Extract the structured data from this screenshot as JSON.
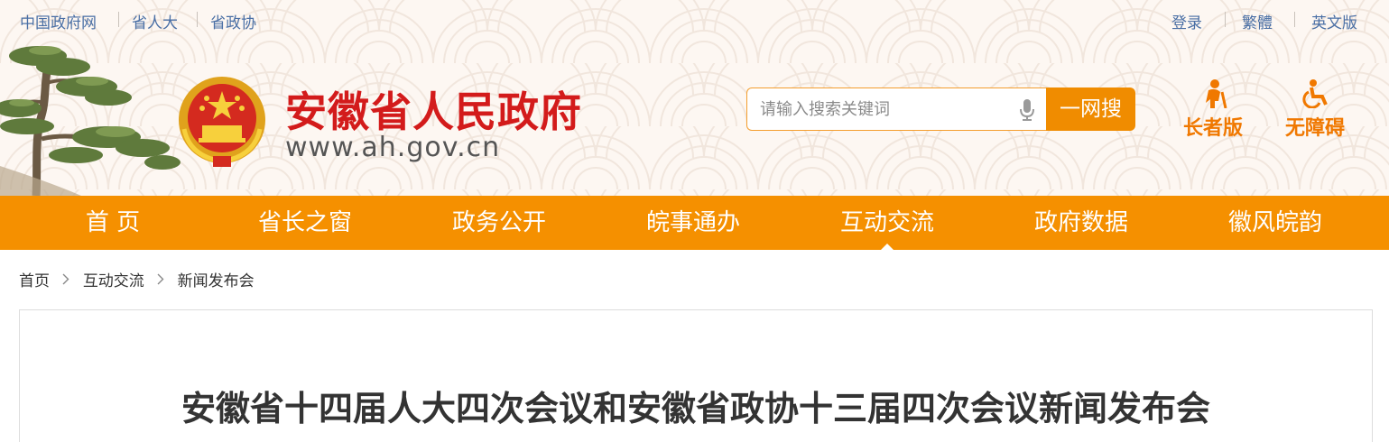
{
  "colors": {
    "accent_orange": "#f59000",
    "title_red": "#d31b1b",
    "link_blue": "#4a6fa5",
    "mode_orange": "#f07800"
  },
  "topbar": {
    "left_links": [
      "中国政府网",
      "省人大",
      "省政协"
    ],
    "right_links": [
      "登录",
      "繁體",
      "英文版"
    ]
  },
  "branding": {
    "title": "安徽省人民政府",
    "url": "www.ah.gov.cn",
    "emblem_icon": "national-emblem-icon",
    "tree_icon": "huangshan-pine-tree-icon"
  },
  "search": {
    "placeholder": "请输入搜索关键词",
    "value": "",
    "button_label": "一网搜",
    "mic_icon": "microphone-icon"
  },
  "modes": [
    {
      "label": "长者版",
      "icon": "elderly-person-icon"
    },
    {
      "label": "无障碍",
      "icon": "wheelchair-icon"
    }
  ],
  "nav": {
    "items": [
      {
        "label": "首 页"
      },
      {
        "label": "省长之窗"
      },
      {
        "label": "政务公开"
      },
      {
        "label": "皖事通办"
      },
      {
        "label": "互动交流",
        "active": true
      },
      {
        "label": "政府数据"
      },
      {
        "label": "徽风皖韵"
      }
    ]
  },
  "breadcrumb": {
    "items": [
      "首页",
      "互动交流",
      "新闻发布会"
    ],
    "separator_icon": "chevron-right-icon"
  },
  "article": {
    "title": "安徽省十四届人大四次会议和安徽省政协十三届四次会议新闻发布会"
  }
}
